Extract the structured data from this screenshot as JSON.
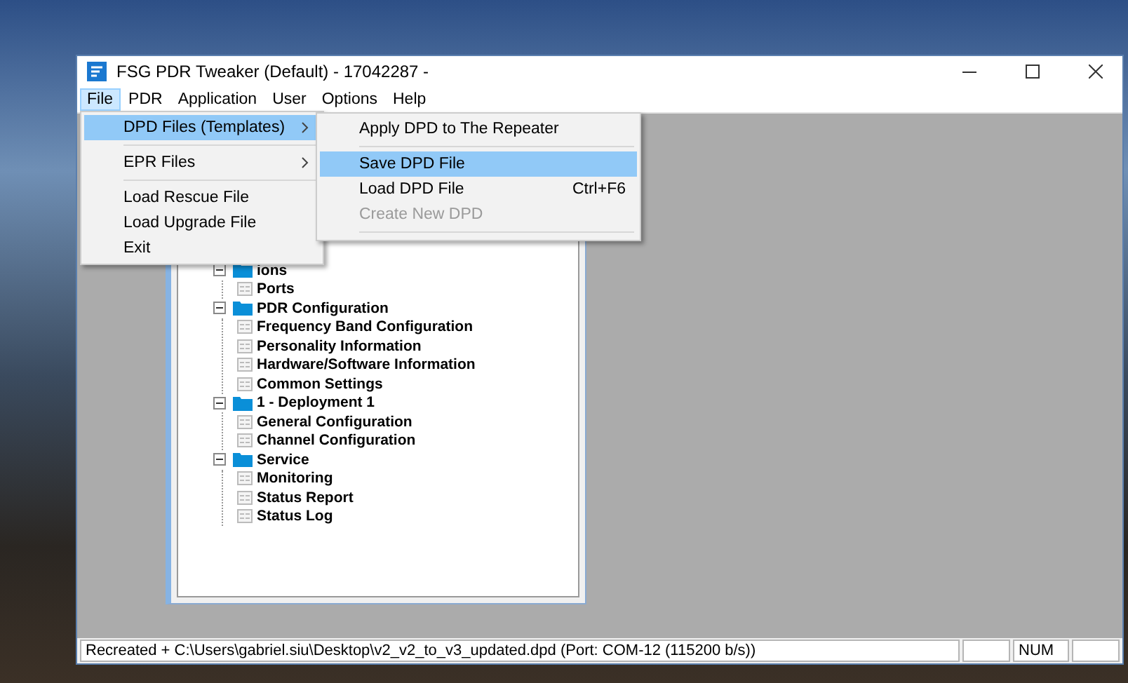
{
  "window": {
    "title": "FSG PDR Tweaker (Default) - 17042287 -"
  },
  "menu_bar": [
    {
      "label": "File",
      "selected": true
    },
    {
      "label": "PDR",
      "selected": false
    },
    {
      "label": "Application",
      "selected": false
    },
    {
      "label": "User",
      "selected": false
    },
    {
      "label": "Options",
      "selected": false
    },
    {
      "label": "Help",
      "selected": false
    }
  ],
  "file_menu": [
    {
      "label": "DPD Files (Templates)",
      "submenu": true,
      "selected": true,
      "separator_after": true
    },
    {
      "label": "EPR Files",
      "submenu": true,
      "selected": false,
      "separator_after": true
    },
    {
      "label": "Load Rescue File",
      "submenu": false,
      "selected": false,
      "separator_after": false
    },
    {
      "label": "Load Upgrade File",
      "submenu": false,
      "selected": false,
      "separator_after": false
    },
    {
      "label": "Exit",
      "submenu": false,
      "selected": false,
      "separator_after": false
    }
  ],
  "dpd_submenu": [
    {
      "label": "Apply DPD to The Repeater",
      "selected": false,
      "disabled": false,
      "separator_after": true
    },
    {
      "label": "Save DPD File",
      "selected": true,
      "disabled": false,
      "separator_after": false
    },
    {
      "label": "Load DPD File",
      "shortcut": "Ctrl+F6",
      "selected": false,
      "disabled": false,
      "separator_after": false
    },
    {
      "label": "Create New DPD",
      "selected": false,
      "disabled": true,
      "separator_after": true
    }
  ],
  "tree": [
    {
      "label": "ions",
      "expanded": true,
      "children": [
        {
          "label": "Ports"
        }
      ]
    },
    {
      "label": "PDR Configuration",
      "expanded": true,
      "children": [
        {
          "label": "Frequency Band Configuration"
        },
        {
          "label": "Personality Information"
        },
        {
          "label": "Hardware/Software Information"
        },
        {
          "label": "Common Settings"
        }
      ]
    },
    {
      "label": "1 - Deployment 1",
      "expanded": true,
      "children": [
        {
          "label": "General Configuration"
        },
        {
          "label": "Channel Configuration"
        }
      ]
    },
    {
      "label": "Service",
      "expanded": true,
      "children": [
        {
          "label": "Monitoring"
        },
        {
          "label": "Status Report"
        },
        {
          "label": "Status Log"
        }
      ]
    }
  ],
  "status_bar": {
    "text": "Recreated + C:\\Users\\gabriel.siu\\Desktop\\v2_v2_to_v3_updated.dpd  (Port: COM-12  (115200 b/s))",
    "indicator": "NUM"
  }
}
